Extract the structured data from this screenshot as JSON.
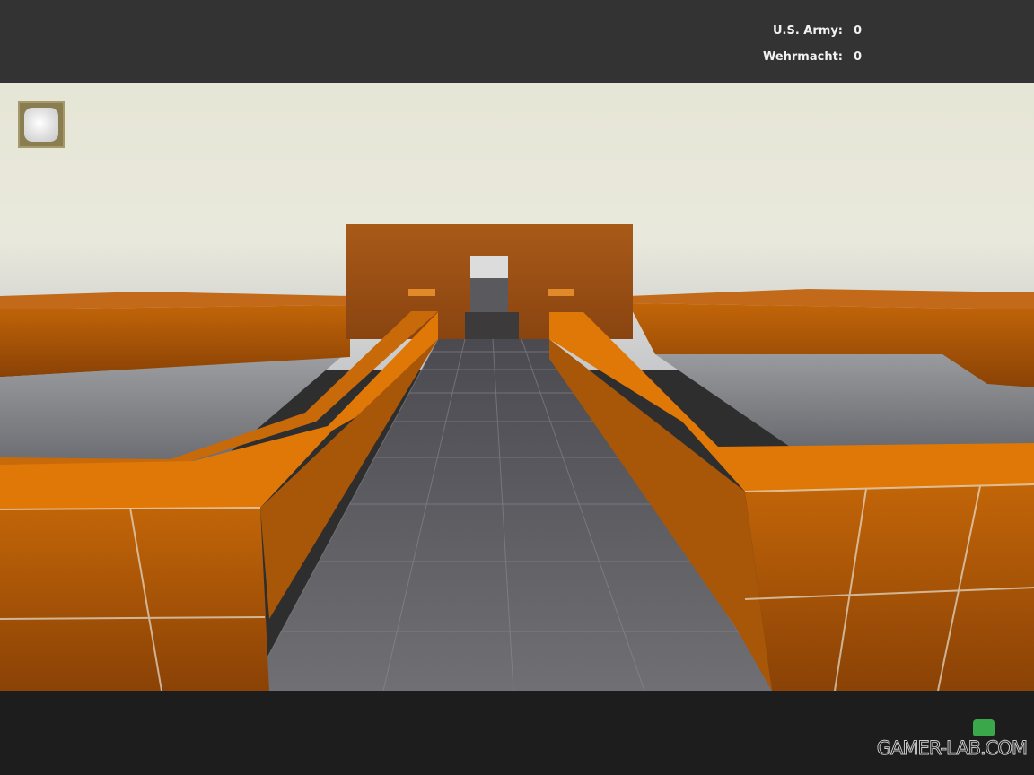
{
  "scoreboard": {
    "teams": [
      {
        "name": "U.S. Army:",
        "score": "0"
      },
      {
        "name": "Wehrmacht:",
        "score": "0"
      }
    ]
  },
  "minimap": {
    "icon": "compass-icon"
  },
  "watermark": {
    "text": "GAMER-LAB.COM"
  },
  "colors": {
    "hud_bar": "#333333",
    "crate_top": "#e07808",
    "crate_side": "#b45a08",
    "floor": "#606064",
    "sky": "#e4e3d8",
    "water": "#8a8a8e"
  }
}
